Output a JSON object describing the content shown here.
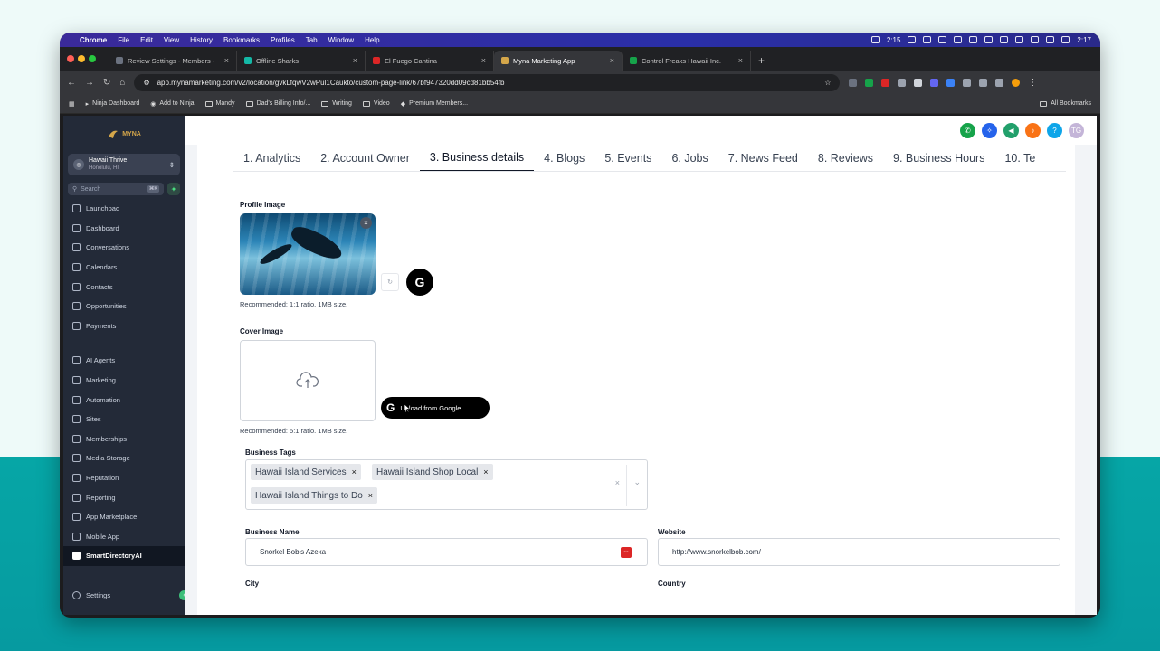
{
  "menubar": {
    "app": "Chrome",
    "menus": [
      "File",
      "Edit",
      "View",
      "History",
      "Bookmarks",
      "Profiles",
      "Tab",
      "Window",
      "Help"
    ],
    "timer": "2:15",
    "clock": "2:17"
  },
  "browser": {
    "tabs": [
      {
        "title": "Review Settings - Members -",
        "color": "#6b7280"
      },
      {
        "title": "Offline Sharks",
        "color": "#14b8a6"
      },
      {
        "title": "El Fuego Cantina",
        "color": "#dc2626"
      },
      {
        "title": "Myna Marketing App",
        "color": "#d4a64a"
      },
      {
        "title": "Control Freaks Hawaii Inc.",
        "color": "#16a34a"
      }
    ],
    "url": "app.mynamarketing.com/v2/location/gvkLfqwV2wPul1Caukto/custom-page-link/67bf947320dd09cd81bb54fb",
    "bookmarks": [
      "Ninja Dashboard",
      "Add to Ninja",
      "Mandy",
      "Dad's Billing Info/...",
      "Writing",
      "Video",
      "Premium Members..."
    ],
    "all_bookmarks": "All Bookmarks"
  },
  "sidebar": {
    "logo": "MYNA",
    "account_name": "Hawaii Thrive",
    "account_location": "Honolulu, HI",
    "search_placeholder": "Search",
    "search_kbd": "⌘K",
    "nav_top": [
      "Launchpad",
      "Dashboard",
      "Conversations",
      "Calendars",
      "Contacts",
      "Opportunities",
      "Payments"
    ],
    "nav_bottom": [
      "AI Agents",
      "Marketing",
      "Automation",
      "Sites",
      "Memberships",
      "Media Storage",
      "Reputation",
      "Reporting",
      "App Marketplace",
      "Mobile App",
      "SmartDirectoryAI"
    ],
    "settings": "Settings"
  },
  "header_icons": {
    "avatar_initials": "TG",
    "colors": [
      "#16a34a",
      "#2563eb",
      "#22a06b",
      "#f97316",
      "#0ea5e9",
      "#c4b5d8"
    ]
  },
  "tabs": [
    "1. Analytics",
    "2. Account Owner",
    "3. Business details",
    "4. Blogs",
    "5. Events",
    "6. Jobs",
    "7. News Feed",
    "8. Reviews",
    "9. Business Hours",
    "10. Te"
  ],
  "form": {
    "profile_label": "Profile Image",
    "profile_hint": "Recommended: 1:1 ratio. 1MB size.",
    "cover_label": "Cover Image",
    "cover_hint": "Recommended: 5:1 ratio. 1MB size.",
    "upload_google": "Upload from Google",
    "tags_label": "Business Tags",
    "tags": [
      "Hawaii Island Services",
      "Hawaii Island Shop Local",
      "Hawaii Island Things to Do"
    ],
    "business_name_label": "Business Name",
    "business_name": "Snorkel Bob's Azeka",
    "website_label": "Website",
    "website": "http://www.snorkelbob.com/",
    "city_label": "City",
    "country_label": "Country"
  }
}
